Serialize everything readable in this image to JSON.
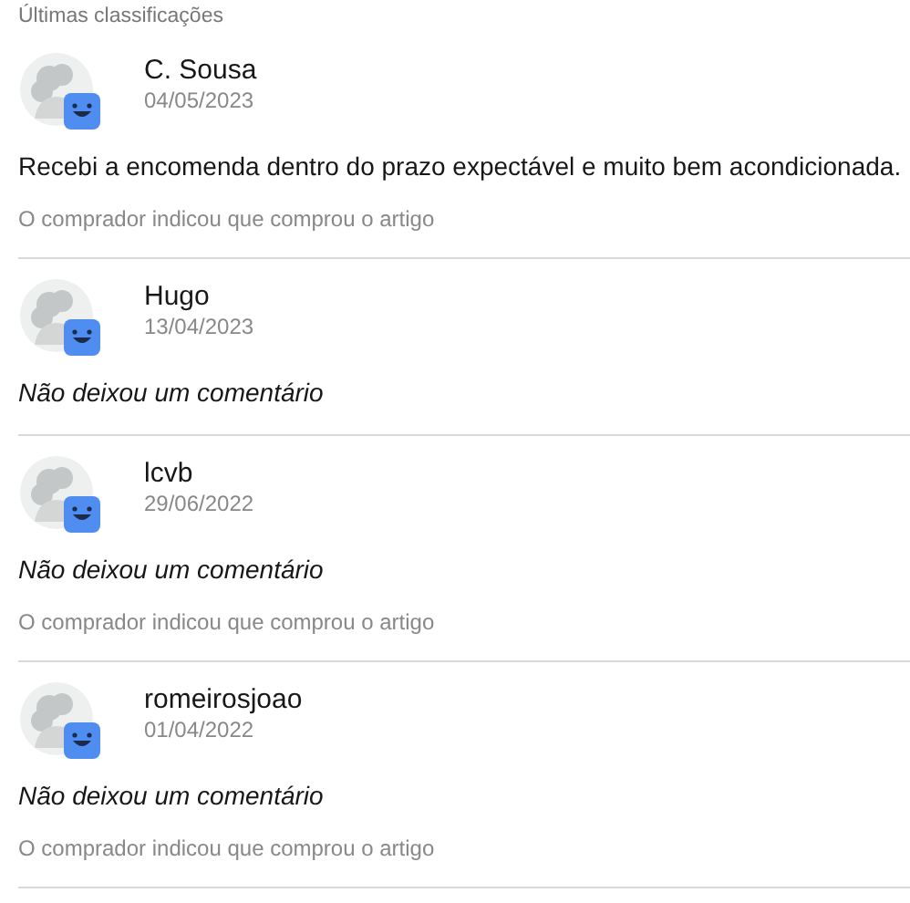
{
  "section_title": "Últimas classificações",
  "reviews": [
    {
      "name": "C. Sousa",
      "date": "04/05/2023",
      "comment": {
        "kind": "text",
        "text": "Recebi a encomenda dentro do prazo expectável e muito bem acondicionada."
      },
      "note": "O comprador indicou que comprou o artigo"
    },
    {
      "name": "Hugo",
      "date": "13/04/2023",
      "comment": {
        "kind": "empty",
        "text": "Não deixou um comentário"
      }
    },
    {
      "name": "lcvb",
      "date": "29/06/2022",
      "comment": {
        "kind": "empty",
        "text": "Não deixou um comentário"
      },
      "note": "O comprador indicou que comprou o artigo"
    },
    {
      "name": "romeirosjoao",
      "date": "01/04/2022",
      "comment": {
        "kind": "empty",
        "text": "Não deixou um comentário"
      },
      "note": "O comprador indicou que comprou o artigo"
    }
  ]
}
